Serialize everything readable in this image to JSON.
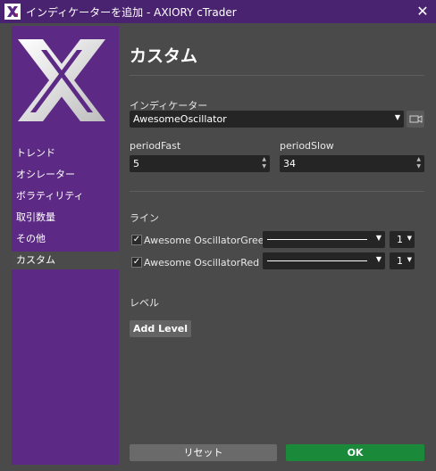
{
  "window": {
    "title": "インディケーターを追加 - AXIORY cTrader",
    "app_icon": "axiory-x-icon",
    "close_icon": "close-icon"
  },
  "sidebar": {
    "logo": "axiory-x-logo",
    "items": [
      {
        "label": "トレンド",
        "active": false
      },
      {
        "label": "オシレーター",
        "active": false
      },
      {
        "label": "ボラティリティ",
        "active": false
      },
      {
        "label": "取引数量",
        "active": false
      },
      {
        "label": "その他",
        "active": false
      },
      {
        "label": "カスタム",
        "active": true
      }
    ]
  },
  "main": {
    "title": "カスタム",
    "indicator_label": "インディケーター",
    "indicator_value": "AwesomeOscillator",
    "indicator_button_icon": "camera-icon",
    "params": [
      {
        "label": "periodFast",
        "value": "5"
      },
      {
        "label": "periodSlow",
        "value": "34"
      }
    ],
    "lines_label": "ライン",
    "lines": [
      {
        "label": "Awesome OscillatorGreen",
        "checked": true,
        "width": "1"
      },
      {
        "label": "Awesome OscillatorRed",
        "checked": true,
        "width": "1"
      }
    ],
    "levels_label": "レベル",
    "add_level_label": "Add Level"
  },
  "footer": {
    "reset_label": "リセット",
    "ok_label": "OK"
  },
  "colors": {
    "titlebar": "#4a2370",
    "sidebar": "#5c2a85",
    "background": "#4a4a4a",
    "ok": "#1a8a3a"
  }
}
